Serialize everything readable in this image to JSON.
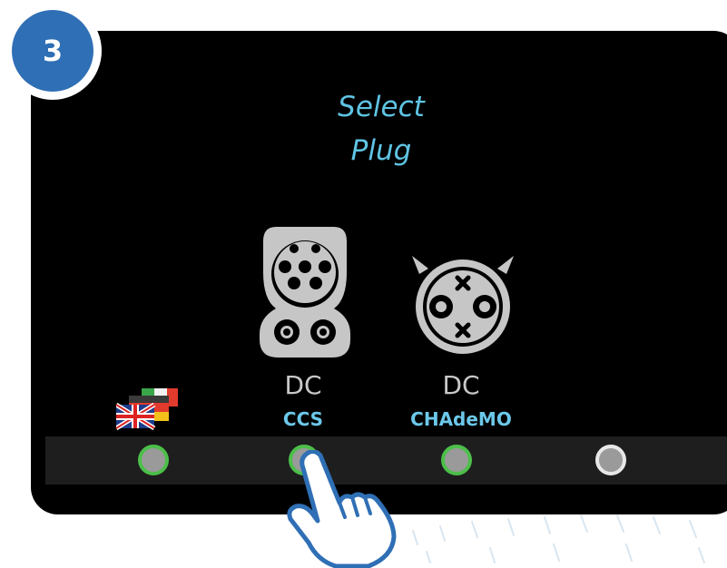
{
  "step": {
    "number": "3"
  },
  "screen": {
    "title_line1": "Select",
    "title_line2": "Plug",
    "plugs": [
      {
        "type": "DC",
        "name": "CCS",
        "icon": "ccs-plug-icon"
      },
      {
        "type": "DC",
        "name": "CHAdeMO",
        "icon": "chademo-plug-icon"
      }
    ],
    "language_icon": "language-flags-icon"
  },
  "buttons": [
    {
      "icon": "soft-button",
      "state": "active"
    },
    {
      "icon": "soft-button",
      "state": "active"
    },
    {
      "icon": "soft-button",
      "state": "active"
    },
    {
      "icon": "soft-button",
      "state": "inactive"
    }
  ],
  "colors": {
    "accent": "#5fc4e4",
    "badge": "#2f6fb5",
    "button_ring_active": "#4cbf4a",
    "screen_bg": "#000000"
  }
}
